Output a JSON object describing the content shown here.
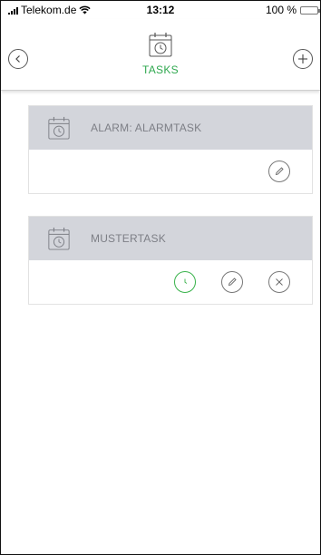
{
  "status_bar": {
    "carrier": "Telekom.de",
    "time": "13:12",
    "battery": "100 %",
    "battery_level": 1.0
  },
  "nav": {
    "title": "TASKS",
    "back_icon": "chevron-left-icon",
    "add_icon": "plus-icon",
    "title_icon": "calendar-clock-icon",
    "accent_color": "#2fa84f"
  },
  "tasks": [
    {
      "title": "ALARM: ALARMTASK",
      "actions": [
        "edit"
      ]
    },
    {
      "title": "MUSTERTASK",
      "actions": [
        "schedule",
        "edit",
        "delete"
      ]
    }
  ],
  "colors": {
    "card_header_bg": "#d3d5db",
    "card_header_text": "#7d7f86",
    "schedule_green": "#38b24a"
  }
}
